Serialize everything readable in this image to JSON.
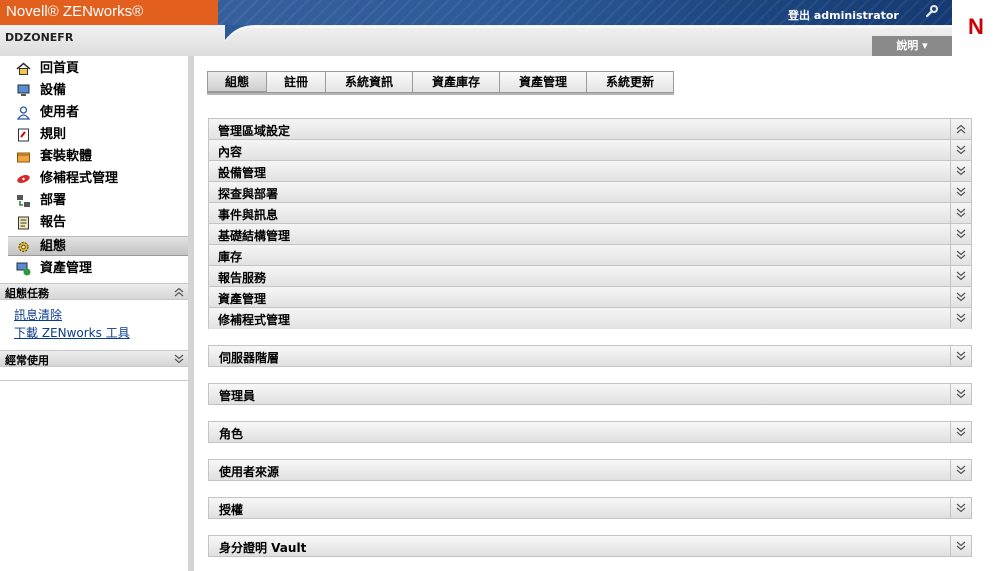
{
  "header": {
    "product": "Novell® ZENworks®",
    "logout": "登出 administrator",
    "zone": "DDZONEFR",
    "help": "說明 ▾",
    "logo_letter": "N"
  },
  "sidebar": {
    "items": [
      {
        "label": "回首頁",
        "icon": "home-icon"
      },
      {
        "label": "設備",
        "icon": "monitor-icon"
      },
      {
        "label": "使用者",
        "icon": "user-icon"
      },
      {
        "label": "規則",
        "icon": "policy-icon"
      },
      {
        "label": "套裝軟體",
        "icon": "bundle-icon"
      },
      {
        "label": "修補程式管理",
        "icon": "patch-icon"
      },
      {
        "label": "部署",
        "icon": "deployment-icon"
      },
      {
        "label": "報告",
        "icon": "report-icon"
      },
      {
        "label": "組態",
        "icon": "gear-icon"
      },
      {
        "label": "資產管理",
        "icon": "asset-icon"
      }
    ],
    "active_item": "組態",
    "config_tasks": {
      "title": "組態任務",
      "links": [
        "訊息清除",
        "下載 ZENworks 工具"
      ]
    },
    "frequently_used": {
      "title": "經常使用"
    }
  },
  "tabs": [
    "組態",
    "註冊",
    "系統資訊",
    "資產庫存",
    "資產管理",
    "系統更新"
  ],
  "active_tab": "組態",
  "zone_settings": {
    "title": "管理區域設定",
    "items": [
      "內容",
      "設備管理",
      "探查與部署",
      "事件與訊息",
      "基礎結構管理",
      "庫存",
      "報告服務",
      "資產管理",
      "修補程式管理"
    ]
  },
  "sections": [
    "伺服器階層",
    "管理員",
    "角色",
    "使用者來源",
    "授權",
    "身分證明 Vault"
  ],
  "colors": {
    "brand_orange": "#e25f1d",
    "banner_blue": "#2d5a97",
    "link_blue": "#0b3d8e",
    "logo_red": "#cc0000"
  }
}
